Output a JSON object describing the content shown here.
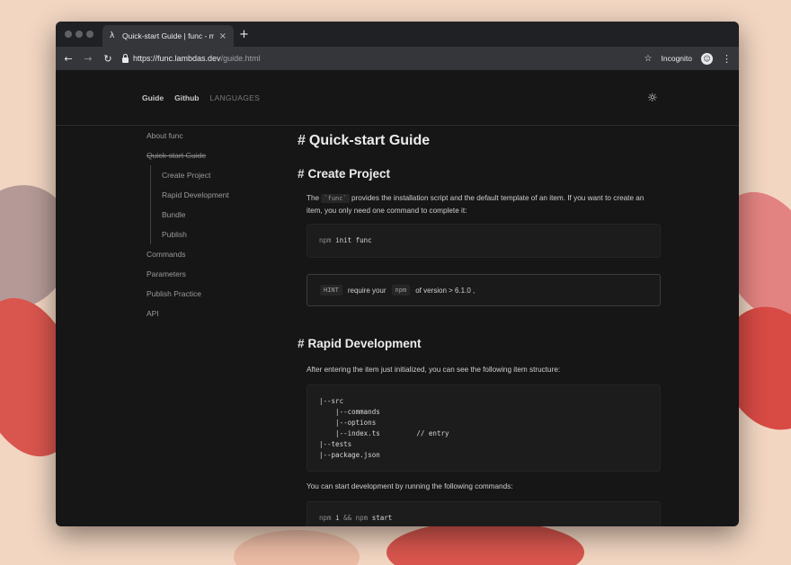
{
  "browser": {
    "tab_favicon": "λ",
    "tab_title": "Quick-start Guide | func - moder",
    "tab_close": "×",
    "new_tab": "+",
    "back": "←",
    "forward": "→",
    "reload": "↻",
    "url_host": "https://func.lambdas.dev",
    "url_path": "/guide.html",
    "bookmark": "☆",
    "incognito_label": "Incognito",
    "incognito_avatar": "☺",
    "menu": "⋮"
  },
  "header": {
    "nav": [
      "Guide",
      "Github",
      "LANGUAGES"
    ],
    "theme_icon": "☼"
  },
  "sidebar": {
    "items": [
      "About func",
      "Quick-start Guide",
      "Commands",
      "Parameters",
      "Publish Practice",
      "API"
    ],
    "subitems": [
      "Create Project",
      "Rapid Development",
      "Bundle",
      "Publish"
    ]
  },
  "content": {
    "hash": "#",
    "title": "Quick-start Guide",
    "section1": {
      "heading": "Create Project",
      "p_before": "The",
      "p_code": "`func`",
      "p_after": "provides the installation script and the default template of an item. If you want to create an item, you only need one command to complete it:",
      "code_kw": "npm",
      "code_rest": "init func",
      "hint_tag": "HINT",
      "hint_text1": "require your",
      "hint_code": "npm",
      "hint_text2": "of version > 6.1.0 ,"
    },
    "section2": {
      "heading": "Rapid Development",
      "p1": "After entering the item just initialized, you can see the following item structure:",
      "tree": "|--src\n    |--commands\n    |--options\n    |--index.ts         // entry\n|--tests\n|--package.json",
      "p2": "You can start development by running the following commands:",
      "code_kw1": "npm",
      "code_mid": "i",
      "code_op": "&&",
      "code_kw2": "npm",
      "code_end": "start"
    }
  },
  "colors": {
    "background": "#f2d6c2",
    "page": "#161616",
    "accent_red": "#d9564e"
  }
}
